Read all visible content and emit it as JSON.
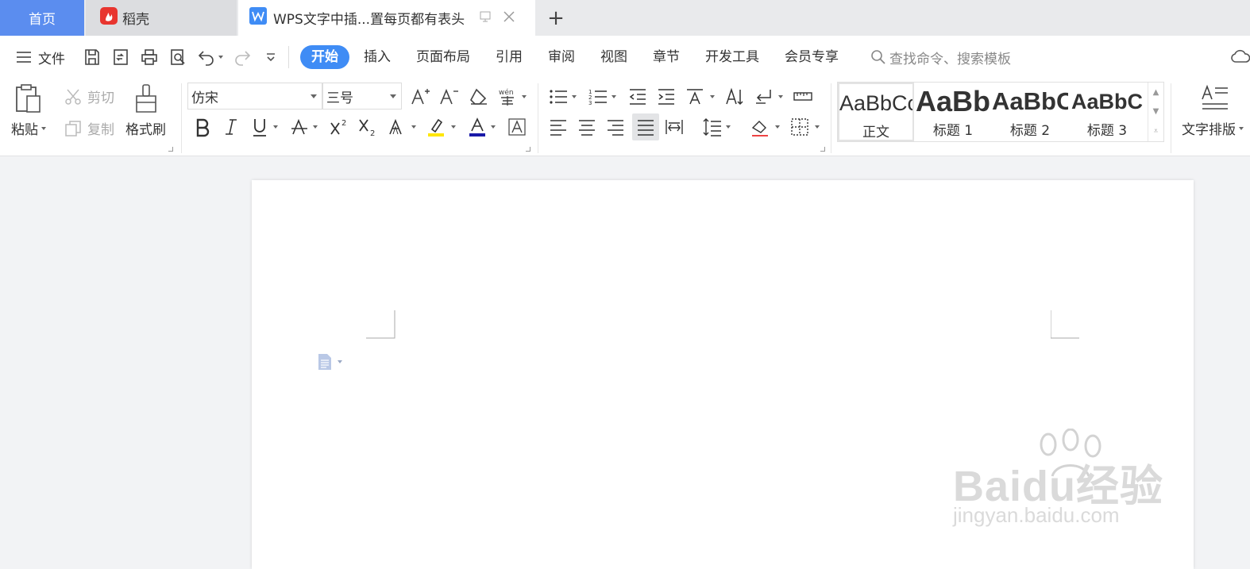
{
  "tabs": {
    "home": "首页",
    "daoke": "稻壳",
    "doc_title": "WPS文字中插...置每页都有表头",
    "add": "+"
  },
  "menu": {
    "file": "文件",
    "items": [
      "开始",
      "插入",
      "页面布局",
      "引用",
      "审阅",
      "视图",
      "章节",
      "开发工具",
      "会员专享"
    ],
    "active": "开始",
    "search_placeholder": "查找命令、搜索模板"
  },
  "toolbar": {
    "paste": "粘贴",
    "cut": "剪切",
    "copy": "复制",
    "format_painter": "格式刷",
    "font": "仿宋",
    "font_size": "三号",
    "text_layout": "文字排版"
  },
  "styles": [
    {
      "sample": "AaBbCcDd",
      "name": "正文"
    },
    {
      "sample": "AaBb",
      "name": "标题 1"
    },
    {
      "sample": "AaBbC",
      "name": "标题 2"
    },
    {
      "sample": "AaBbC",
      "name": "标题 3"
    }
  ],
  "watermark": {
    "brand": "Baidu经验",
    "url": "jingyan.baidu.com"
  },
  "colors": {
    "accent": "#3f8cf5",
    "home_tab": "#5b8def",
    "highlight": "#ffe600",
    "font_color": "#1a1aa8"
  }
}
